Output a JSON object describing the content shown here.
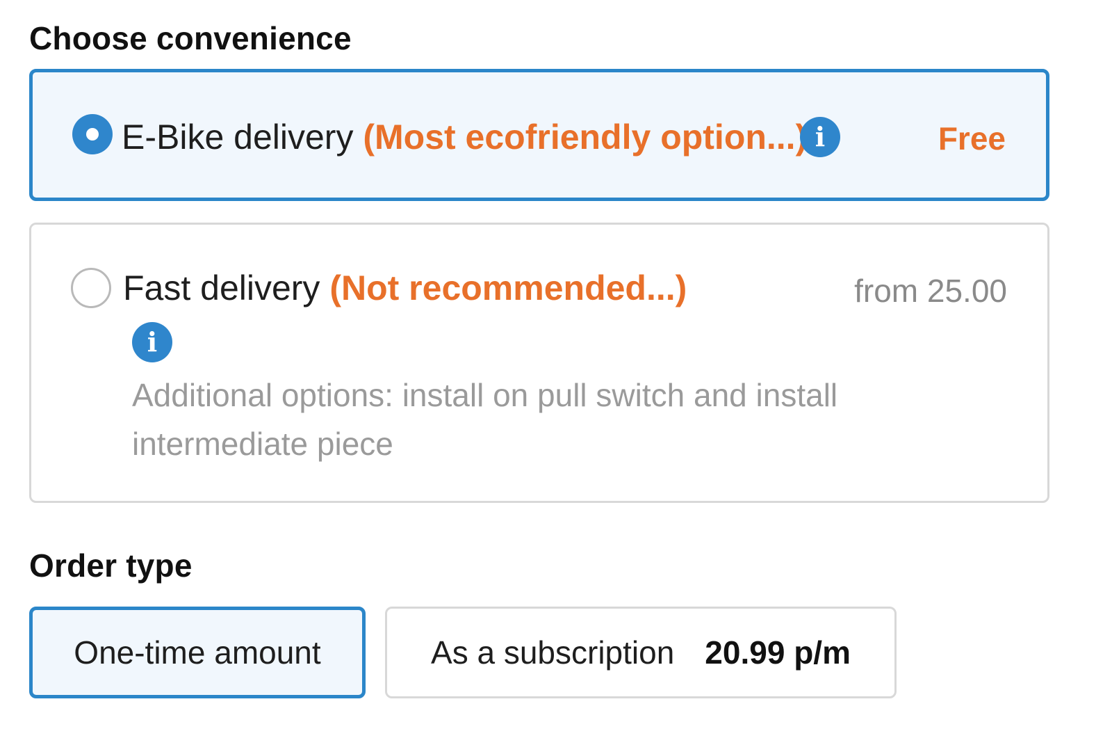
{
  "convenience": {
    "title": "Choose convenience",
    "options": [
      {
        "label": "E-Bike delivery",
        "note": "(Most ecofriendly option...)",
        "price": "Free",
        "selected": true
      },
      {
        "label": "Fast delivery",
        "note": "(Not recommended...)",
        "price": "from 25.00",
        "details": "Additional options: install on pull switch and install intermediate piece",
        "selected": false
      }
    ],
    "info_glyph": "i"
  },
  "order_type": {
    "title": "Order type",
    "one_time_label": "One-time amount",
    "subscription_label": "As a subscription",
    "subscription_price": "20.99 p/m",
    "selected": "One-time amount"
  },
  "colors": {
    "accent_blue": "#2b86c9",
    "accent_orange": "#e8702a",
    "selected_bg": "#f1f7fd"
  }
}
